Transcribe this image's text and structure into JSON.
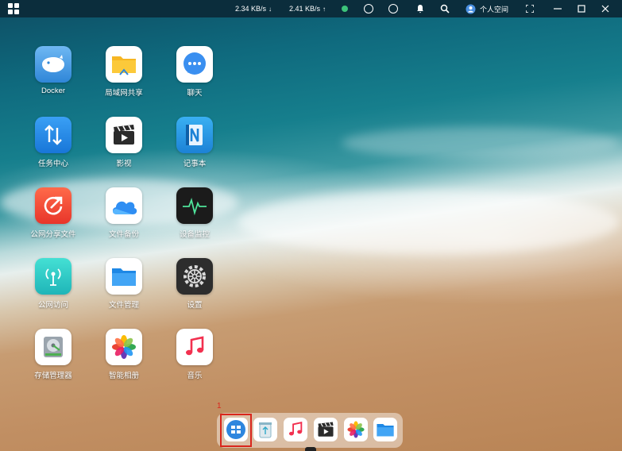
{
  "topbar": {
    "download_speed": "2.34 KB/s",
    "upload_speed": "2.41 KB/s",
    "user_label": "个人空间",
    "status_color": "#3cc37a"
  },
  "apps": [
    {
      "label": "Docker",
      "icon": "whale-icon"
    },
    {
      "label": "局域网共享",
      "icon": "shared-folder-icon"
    },
    {
      "label": "聊天",
      "icon": "chat-bubble-icon"
    },
    {
      "label": "任务中心",
      "icon": "transfer-arrows-icon"
    },
    {
      "label": "影视",
      "icon": "clapperboard-icon"
    },
    {
      "label": "记事本",
      "icon": "notebook-icon"
    },
    {
      "label": "公网分享文件",
      "icon": "share-arrow-icon"
    },
    {
      "label": "文件备份",
      "icon": "cloud-backup-icon"
    },
    {
      "label": "设备监控",
      "icon": "heartbeat-monitor-icon"
    },
    {
      "label": "公网访问",
      "icon": "antenna-icon"
    },
    {
      "label": "文件管理",
      "icon": "folder-icon"
    },
    {
      "label": "设置",
      "icon": "gear-icon"
    },
    {
      "label": "存储管理器",
      "icon": "hard-drive-icon"
    },
    {
      "label": "智能相册",
      "icon": "photos-icon"
    },
    {
      "label": "音乐",
      "icon": "music-note-icon"
    }
  ],
  "dock": {
    "items": [
      "app-center-icon",
      "recycle-bin-icon",
      "music-note-icon",
      "clapperboard-icon",
      "photos-icon",
      "folder-icon"
    ]
  },
  "annotation": {
    "marker_number": "1"
  }
}
